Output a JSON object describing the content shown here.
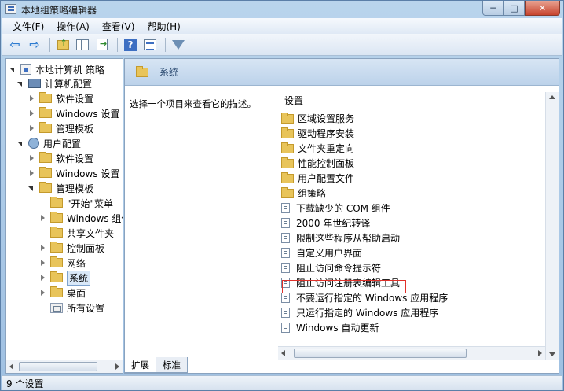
{
  "window": {
    "title": "本地组策略编辑器",
    "min_glyph": "─",
    "max_glyph": "□",
    "close_glyph": "✕"
  },
  "menu": {
    "items": [
      "文件(F)",
      "操作(A)",
      "查看(V)",
      "帮助(H)"
    ]
  },
  "toolbar": {
    "back_glyph": "⇦",
    "forward_glyph": "⇨",
    "help_glyph": "?"
  },
  "tree": {
    "items": [
      {
        "label": "本地计算机 策略",
        "icon": "policy-icon"
      },
      {
        "label": "计算机配置",
        "icon": "computer-icon"
      },
      {
        "label": "软件设置",
        "icon": "folder-icon"
      },
      {
        "label": "Windows 设置",
        "icon": "folder-icon"
      },
      {
        "label": "管理模板",
        "icon": "folder-icon"
      },
      {
        "label": "用户配置",
        "icon": "user-icon"
      },
      {
        "label": "软件设置",
        "icon": "folder-icon"
      },
      {
        "label": "Windows 设置",
        "icon": "folder-icon"
      },
      {
        "label": "管理模板",
        "icon": "folder-icon"
      },
      {
        "label": "\"开始\"菜单",
        "icon": "folder-icon"
      },
      {
        "label": "Windows 组件",
        "icon": "folder-icon"
      },
      {
        "label": "共享文件夹",
        "icon": "folder-icon"
      },
      {
        "label": "控制面板",
        "icon": "folder-icon"
      },
      {
        "label": "网络",
        "icon": "folder-icon"
      },
      {
        "label": "系统",
        "icon": "folder-icon"
      },
      {
        "label": "桌面",
        "icon": "folder-icon"
      },
      {
        "label": "所有设置",
        "icon": "settings-folder-icon"
      }
    ]
  },
  "right_pane": {
    "header_title": "系统",
    "description": "选择一个项目来查看它的描述。",
    "column_header": "设置",
    "items": [
      {
        "label": "区域设置服务",
        "icon": "folder-icon"
      },
      {
        "label": "驱动程序安装",
        "icon": "folder-icon"
      },
      {
        "label": "文件夹重定向",
        "icon": "folder-icon"
      },
      {
        "label": "性能控制面板",
        "icon": "folder-icon"
      },
      {
        "label": "用户配置文件",
        "icon": "folder-icon"
      },
      {
        "label": "组策略",
        "icon": "folder-icon"
      },
      {
        "label": "下载缺少的 COM 组件",
        "icon": "setting-icon"
      },
      {
        "label": "2000 年世纪转译",
        "icon": "setting-icon"
      },
      {
        "label": "限制这些程序从帮助启动",
        "icon": "setting-icon"
      },
      {
        "label": "自定义用户界面",
        "icon": "setting-icon"
      },
      {
        "label": "阻止访问命令提示符",
        "icon": "setting-icon"
      },
      {
        "label": "阻止访问注册表编辑工具",
        "icon": "setting-icon"
      },
      {
        "label": "不要运行指定的 Windows 应用程序",
        "icon": "setting-icon"
      },
      {
        "label": "只运行指定的 Windows 应用程序",
        "icon": "setting-icon"
      },
      {
        "label": "Windows 自动更新",
        "icon": "setting-icon"
      }
    ]
  },
  "tabs": [
    "扩展",
    "标准"
  ],
  "status": "9 个设置",
  "colors": {
    "highlight": "#e0312a",
    "folder": "#e8c45a",
    "header_bg": "#bcd2ea"
  }
}
